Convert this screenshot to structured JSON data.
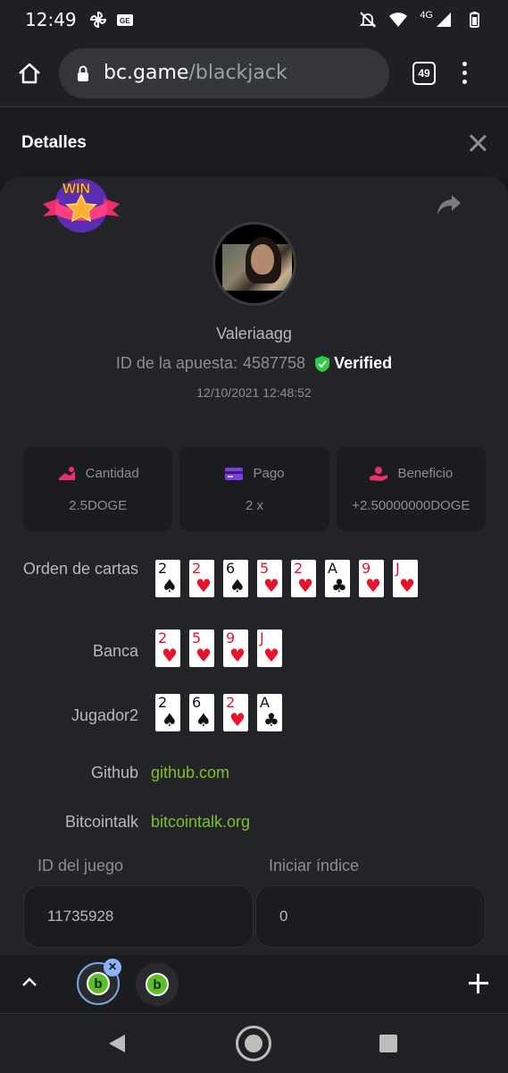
{
  "status_bar": {
    "time": "12:49",
    "network": "4G"
  },
  "browser": {
    "url_domain": "bc.game",
    "url_path": "/blackjack",
    "tab_count": "49"
  },
  "modal": {
    "title": "Detalles"
  },
  "bet": {
    "username": "Valeriaagg",
    "bet_id_label": "ID de la apuesta:",
    "bet_id": "4587758",
    "verified_label": "Verified",
    "timestamp": "12/10/2021 12:48:52",
    "win_badge_text": "WIN"
  },
  "stats": [
    {
      "label": "Cantidad",
      "value": "2.5DOGE",
      "icon": "coins-icon"
    },
    {
      "label": "Pago",
      "value": "2 x",
      "icon": "card-payment-icon"
    },
    {
      "label": "Beneficio",
      "value": "+2.50000000DOGE",
      "icon": "hand-profit-icon"
    }
  ],
  "card_rows": [
    {
      "label": "Orden de cartas",
      "cards": [
        {
          "rank": "2",
          "suit": "♠",
          "color": "black"
        },
        {
          "rank": "2",
          "suit": "♥",
          "color": "red"
        },
        {
          "rank": "6",
          "suit": "♠",
          "color": "black"
        },
        {
          "rank": "5",
          "suit": "♥",
          "color": "red"
        },
        {
          "rank": "2",
          "suit": "♥",
          "color": "red"
        },
        {
          "rank": "A",
          "suit": "♣",
          "color": "black"
        },
        {
          "rank": "9",
          "suit": "♥",
          "color": "red"
        },
        {
          "rank": "J",
          "suit": "♥",
          "color": "red"
        }
      ]
    },
    {
      "label": "Banca",
      "cards": [
        {
          "rank": "2",
          "suit": "♥",
          "color": "red"
        },
        {
          "rank": "5",
          "suit": "♥",
          "color": "red"
        },
        {
          "rank": "9",
          "suit": "♥",
          "color": "red"
        },
        {
          "rank": "J",
          "suit": "♥",
          "color": "red"
        }
      ]
    },
    {
      "label": "Jugador2",
      "cards": [
        {
          "rank": "2",
          "suit": "♠",
          "color": "black"
        },
        {
          "rank": "6",
          "suit": "♠",
          "color": "black"
        },
        {
          "rank": "2",
          "suit": "♥",
          "color": "red"
        },
        {
          "rank": "A",
          "suit": "♣",
          "color": "black"
        }
      ]
    }
  ],
  "links": [
    {
      "label": "Github",
      "value": "github.com"
    },
    {
      "label": "Bitcointalk",
      "value": "bitcointalk.org"
    }
  ],
  "fields": {
    "game_id_label": "ID del juego",
    "game_id_value": "11735928",
    "start_index_label": "Iniciar índice",
    "start_index_value": "0"
  },
  "colors": {
    "accent_green": "#7fbf2a",
    "verified_green": "#2ecc40",
    "background": "#232427"
  }
}
